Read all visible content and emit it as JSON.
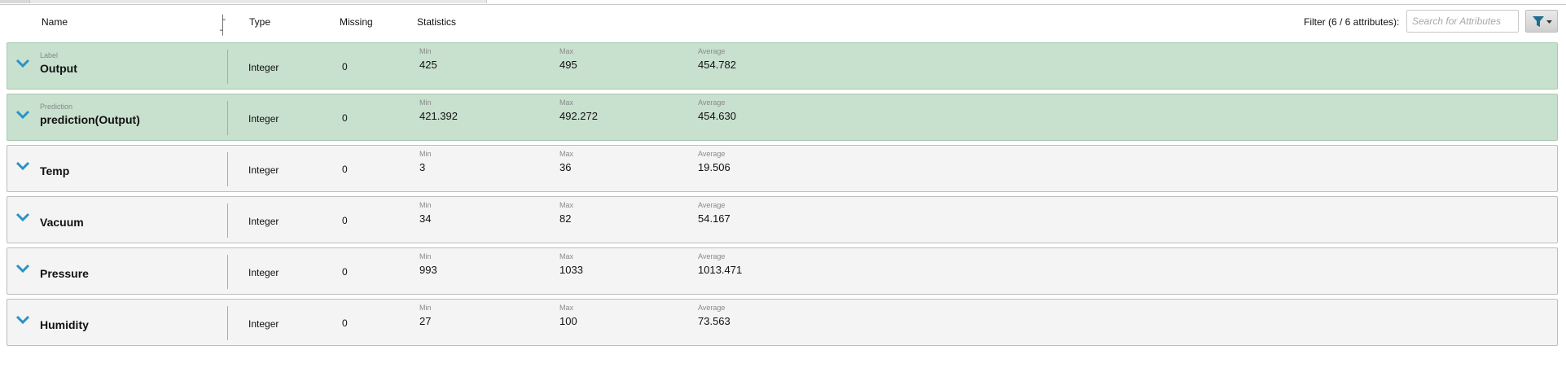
{
  "header": {
    "name": "Name",
    "type": "Type",
    "missing": "Missing",
    "statistics": "Statistics",
    "resize_handle": "├ ┤"
  },
  "filter": {
    "label": "Filter (6 / 6 attributes):",
    "search_placeholder": "Search for Attributes",
    "button_icon": "funnel-icon"
  },
  "stat_labels": {
    "min": "Min",
    "max": "Max",
    "average": "Average"
  },
  "rows": [
    {
      "role": "Label",
      "name": "Output",
      "type": "Integer",
      "missing": "0",
      "min": "425",
      "max": "495",
      "average": "454.782"
    },
    {
      "role": "Prediction",
      "name": "prediction(Output)",
      "type": "Integer",
      "missing": "0",
      "min": "421.392",
      "max": "492.272",
      "average": "454.630"
    },
    {
      "role": "",
      "name": "Temp",
      "type": "Integer",
      "missing": "0",
      "min": "3",
      "max": "36",
      "average": "19.506"
    },
    {
      "role": "",
      "name": "Vacuum",
      "type": "Integer",
      "missing": "0",
      "min": "34",
      "max": "82",
      "average": "54.167"
    },
    {
      "role": "",
      "name": "Pressure",
      "type": "Integer",
      "missing": "0",
      "min": "993",
      "max": "1033",
      "average": "1013.471"
    },
    {
      "role": "",
      "name": "Humidity",
      "type": "Integer",
      "missing": "0",
      "min": "27",
      "max": "100",
      "average": "73.563"
    }
  ],
  "colors": {
    "special_row_bg": "#c8e0ce",
    "regular_row_bg": "#f4f4f4",
    "chevron": "#2a93c8"
  }
}
